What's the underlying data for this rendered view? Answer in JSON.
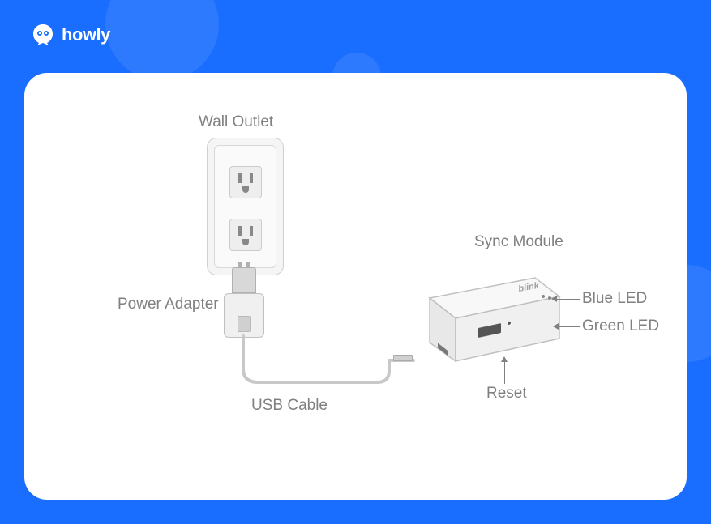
{
  "brand": {
    "name": "howly"
  },
  "diagram": {
    "labels": {
      "wall_outlet": "Wall Outlet",
      "power_adapter": "Power Adapter",
      "usb_cable": "USB Cable",
      "sync_module": "Sync Module",
      "blue_led": "Blue LED",
      "green_led": "Green LED",
      "reset": "Reset"
    },
    "device_brand": "blink"
  }
}
